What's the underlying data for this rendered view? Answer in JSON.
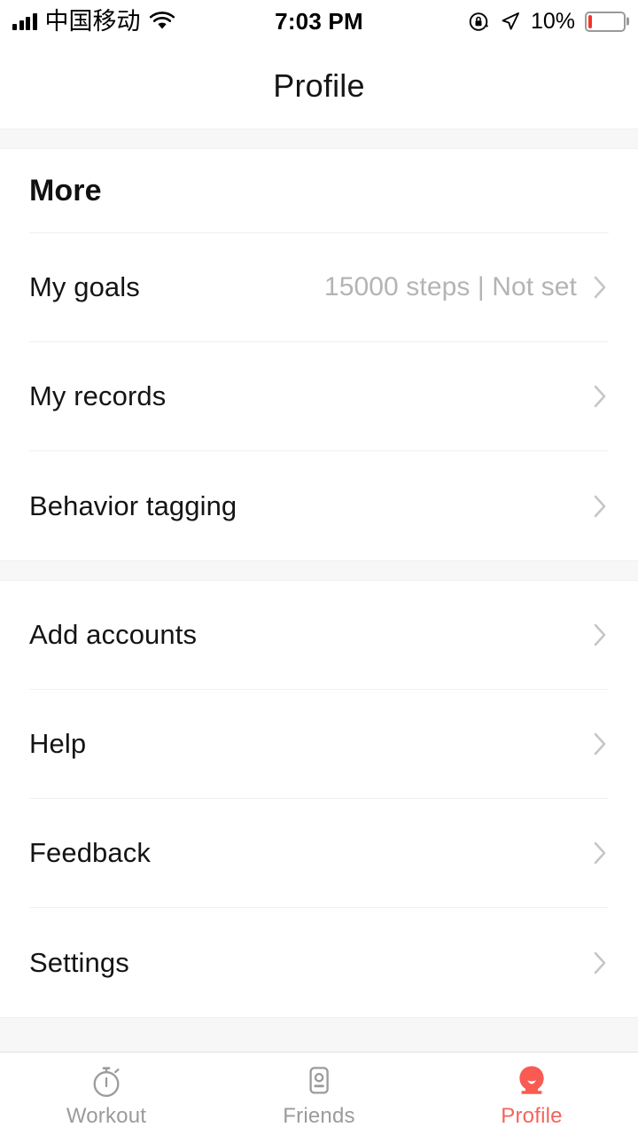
{
  "status_bar": {
    "carrier": "中国移动",
    "time": "7:03 PM",
    "battery_percent": "10%",
    "battery_level": 10,
    "signal_bars": 4,
    "icons": {
      "signal": "signal-bars-icon",
      "wifi": "wifi-icon",
      "rotation_lock": "rotation-lock-icon",
      "location": "location-arrow-icon",
      "battery": "battery-icon"
    }
  },
  "nav": {
    "title": "Profile"
  },
  "main": {
    "section_header": "More",
    "groups": [
      {
        "rows": [
          {
            "label": "My goals",
            "value": "15000 steps | Not set"
          },
          {
            "label": "My records",
            "value": ""
          },
          {
            "label": "Behavior tagging",
            "value": ""
          }
        ]
      },
      {
        "rows": [
          {
            "label": "Add accounts",
            "value": ""
          },
          {
            "label": "Help",
            "value": ""
          },
          {
            "label": "Feedback",
            "value": ""
          },
          {
            "label": "Settings",
            "value": ""
          }
        ]
      }
    ]
  },
  "tabbar": {
    "items": [
      {
        "label": "Workout",
        "icon": "stopwatch-icon",
        "active": false
      },
      {
        "label": "Friends",
        "icon": "contact-card-icon",
        "active": false
      },
      {
        "label": "Profile",
        "icon": "person-head-icon",
        "active": true
      }
    ]
  },
  "colors": {
    "accent": "#f4645c",
    "accent_icon": "#f95b52",
    "battery_low": "#f5342b",
    "text_primary": "#141414",
    "text_muted": "#b4b4b4",
    "divider": "#f1f1f1",
    "group_gap": "#f7f7f7"
  }
}
